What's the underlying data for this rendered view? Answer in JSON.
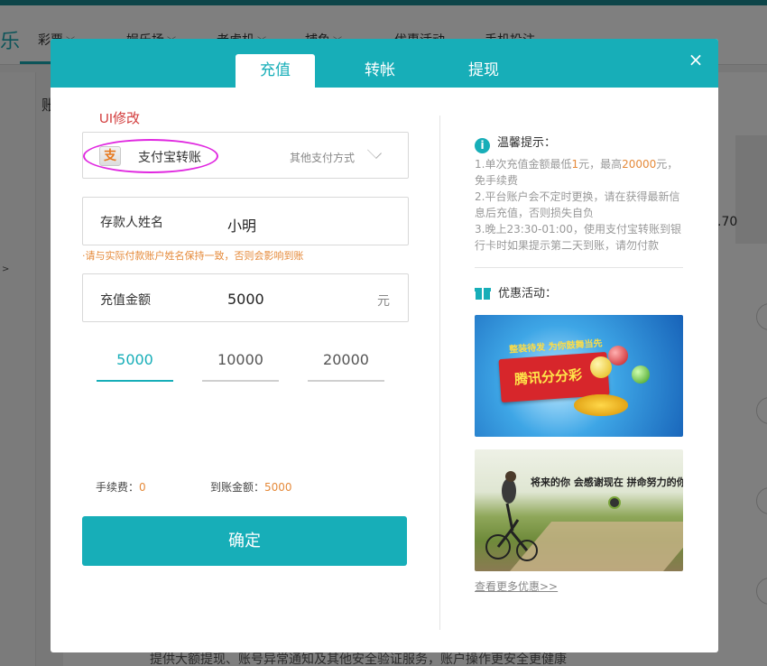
{
  "background": {
    "nav_logo": "乐",
    "nav_items": [
      "彩票",
      "娱乐场",
      "老虎机",
      "捕鱼",
      "优惠活动",
      "手机投注"
    ],
    "side_label": "账",
    "side_arrow": ">",
    "right_value": ".70",
    "bottom_text": "提供大额提现、账号异常通知及其他安全验证服务，账户操作更安全更健康"
  },
  "modal": {
    "tabs": [
      {
        "label": "充值",
        "active": true
      },
      {
        "label": "转帐",
        "active": false
      },
      {
        "label": "提现",
        "active": false
      }
    ],
    "close_icon": "×",
    "ui_note": "UI修改",
    "payment": {
      "icon": "支",
      "method": "支付宝转账",
      "other": "其他支付方式"
    },
    "depositor": {
      "label": "存款人姓名",
      "value": "小明",
      "warning": "·请与实际付款账户姓名保持一致，否则会影响到账"
    },
    "amount": {
      "label": "充值金额",
      "value": "5000",
      "unit": "元"
    },
    "quick_amounts": [
      {
        "label": "5000",
        "active": true
      },
      {
        "label": "10000",
        "active": false
      },
      {
        "label": "20000",
        "active": false
      }
    ],
    "fee": {
      "label": "手续费：",
      "value": "0"
    },
    "arrival": {
      "label": "到账金额：",
      "value": "5000"
    },
    "confirm_label": "确定",
    "tips": {
      "title": "温馨提示：",
      "line1_a": "1.单次充值金额最低",
      "line1_min": "1",
      "line1_b": "元，最高",
      "line1_max": "20000",
      "line1_c": "元，免手续费",
      "line2": "2.平台账户会不定时更换，请在获得最新信息后充值，否则损失自负",
      "line3": "3.晚上23:30-01:00，使用支付宝转账到银行卡时如果提示第二天到账，请勿付款"
    },
    "promo": {
      "title": "优惠活动：",
      "banner1_tag": "整装待发 为你鼓舞当先",
      "banner1_text": "腾讯分分彩",
      "banner2_text": "将来的你 会感谢现在 拼命努力的你!",
      "more_link": "查看更多优惠>>"
    }
  },
  "colors": {
    "accent": "#17aeb8",
    "warning": "#e58a3a",
    "note": "#d23b3b",
    "oval": "#e028e0"
  }
}
